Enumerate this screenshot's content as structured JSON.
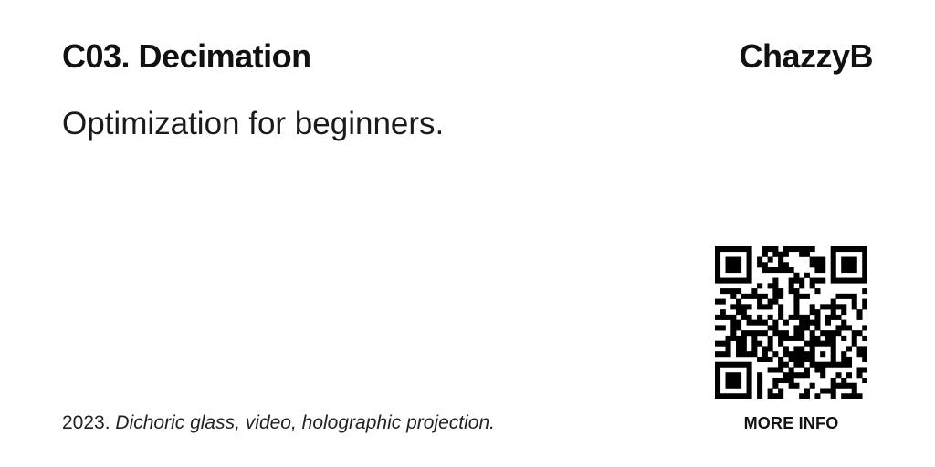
{
  "header": {
    "title": "C03. Decimation",
    "artist": "ChazzyB"
  },
  "description": "Optimization for beginners.",
  "caption": {
    "year": "2023.",
    "medium": "Dichoric glass, video, holographic projection."
  },
  "qr": {
    "icon": "qr-code-icon",
    "link_label": "MORE INFO"
  },
  "colors": {
    "background": "#ffffff",
    "text": "#111111"
  }
}
